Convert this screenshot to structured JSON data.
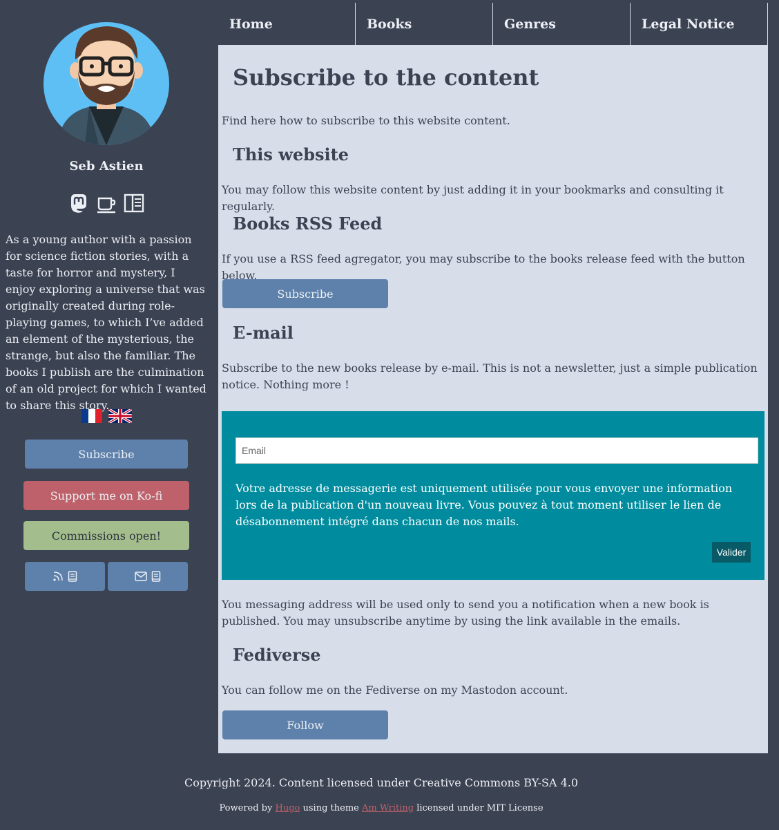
{
  "nav": {
    "items": [
      "Home",
      "Books",
      "Genres",
      "Legal Notice"
    ]
  },
  "sidebar": {
    "author_name": "Seb Astien",
    "social_icons": [
      "mastodon-icon",
      "kofi-cup-icon",
      "book-reader-icon"
    ],
    "bio": "As a young author with a passion for science fiction stories, with a taste for horror and mystery, I enjoy exploring a universe that was originally created during role-playing games, to which I’ve added an element of the mysterious, the strange, but also the familiar. The books I publish are the culmination of an old project for which I wanted to share this story.",
    "languages": [
      "fr-flag-icon",
      "uk-flag-icon"
    ],
    "subscribe_label": "Subscribe",
    "kofi_label": "Support me on Ko-fi",
    "commissions_label": "Commissions open!",
    "feed_buttons": [
      "rss-book-icon",
      "mail-book-icon"
    ]
  },
  "main": {
    "title": "Subscribe to the content",
    "intro": "Find here how to subscribe to this website content.",
    "website": {
      "heading": "This website",
      "text": "You may follow this website content by just adding it in your bookmarks and consulting it regularly."
    },
    "rss": {
      "heading": "Books RSS Feed",
      "text": "If you use a RSS feed agregator, you may subscribe to the books release feed with the button below.",
      "button": "Subscribe"
    },
    "email": {
      "heading": "E-mail",
      "text": "Subscribe to the new books release by e-mail. This is not a newsletter, just a simple publication notice. Nothing more !",
      "placeholder": "Email",
      "notice": "Votre adresse de messagerie est uniquement utilisée pour vous envoyer une information lors de la publication d'un nouveau livre. Vous pouvez à tout moment utiliser le lien de désabonnement intégré dans chacun de nos mails.",
      "submit": "Valider",
      "after": "You messaging address will be used only to send you a notification when a new book is published. You may unsubscribe anytime by using the link available in the emails."
    },
    "fediverse": {
      "heading": "Fediverse",
      "text": "You can follow me on the Fediverse on my Mastodon account.",
      "button": "Follow"
    }
  },
  "footer": {
    "copyright": "Copyright 2024. Content licensed under Creative Commons BY-SA 4.0",
    "powered_prefix": "Powered by",
    "hugo": "Hugo",
    "using_theme": "using theme",
    "theme": "Am Writing",
    "license": "licensed under MIT License"
  },
  "colors": {
    "background": "#3b4252",
    "content": "#d8dee9",
    "button_blue": "#5e81ac",
    "kofi_red": "#bf616a",
    "commissions_green": "#a3be8c",
    "email_panel": "#008c9e"
  }
}
